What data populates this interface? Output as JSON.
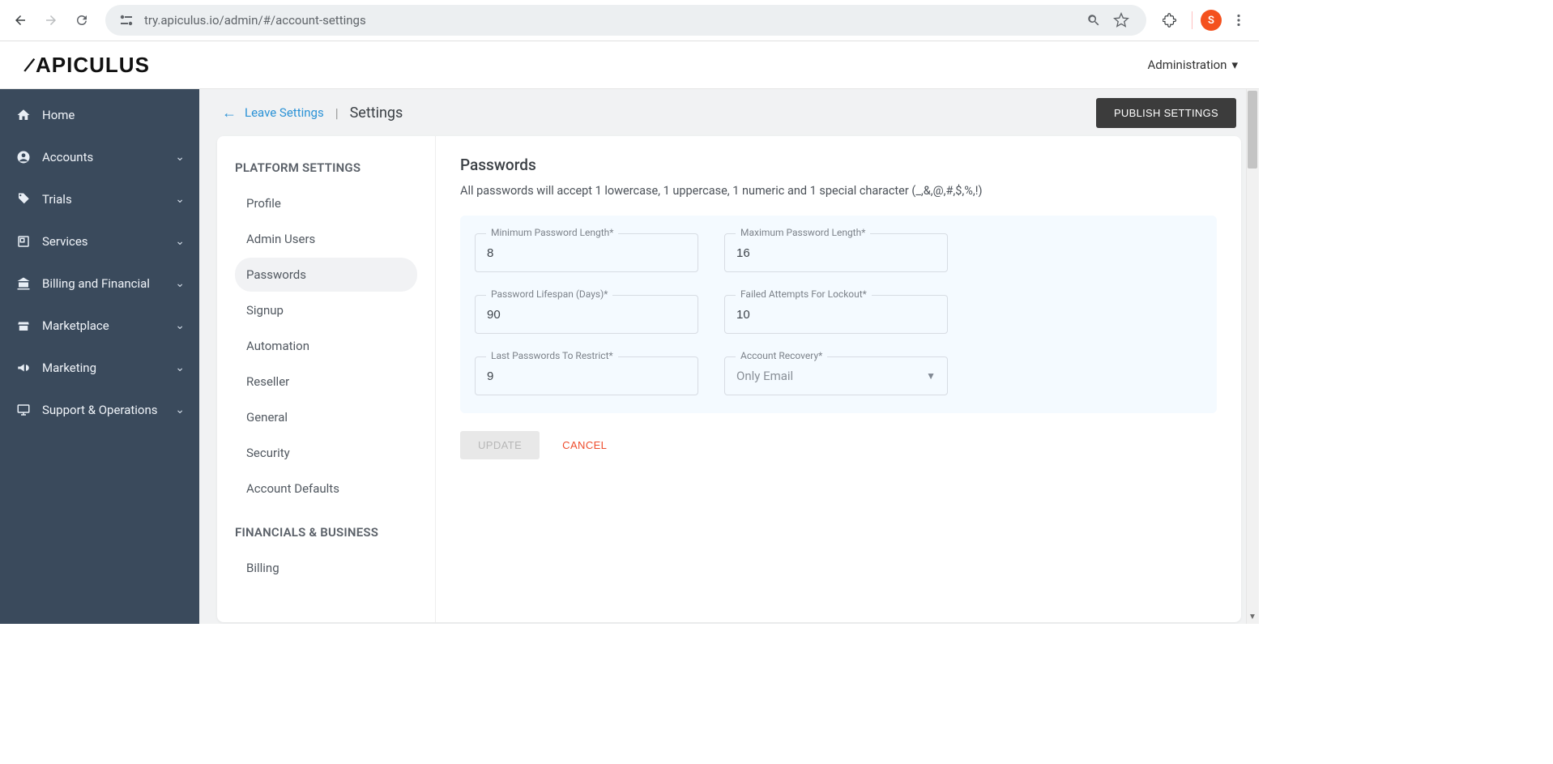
{
  "browser": {
    "url": "try.apiculus.io/admin/#/account-settings",
    "profile_initial": "S"
  },
  "header": {
    "logo_text": "APICULUS",
    "admin_label": "Administration"
  },
  "sidebar": {
    "items": [
      {
        "label": "Home",
        "icon": "home",
        "expandable": false
      },
      {
        "label": "Accounts",
        "icon": "user",
        "expandable": true
      },
      {
        "label": "Trials",
        "icon": "tag",
        "expandable": true
      },
      {
        "label": "Services",
        "icon": "layers",
        "expandable": true
      },
      {
        "label": "Billing and Financial",
        "icon": "bank",
        "expandable": true
      },
      {
        "label": "Marketplace",
        "icon": "store",
        "expandable": true
      },
      {
        "label": "Marketing",
        "icon": "megaphone",
        "expandable": true
      },
      {
        "label": "Support & Operations",
        "icon": "monitor",
        "expandable": true
      }
    ]
  },
  "top_actions": {
    "leave_label": "Leave Settings",
    "title": "Settings",
    "publish_label": "PUBLISH SETTINGS"
  },
  "settings_nav": {
    "section1_title": "PLATFORM SETTINGS",
    "section1": [
      "Profile",
      "Admin Users",
      "Passwords",
      "Signup",
      "Automation",
      "Reseller",
      "General",
      "Security",
      "Account Defaults"
    ],
    "section2_title": "FINANCIALS & BUSINESS",
    "section2": [
      "Billing"
    ],
    "active": "Passwords"
  },
  "panel": {
    "title": "Passwords",
    "hint": "All passwords will accept 1 lowercase, 1 uppercase, 1 numeric and 1 special character (_,&,@,#,$,%,!)",
    "fields": {
      "min_len": {
        "label": "Minimum Password Length*",
        "value": "8"
      },
      "max_len": {
        "label": "Maximum Password Length*",
        "value": "16"
      },
      "lifespan": {
        "label": "Password Lifespan (Days)*",
        "value": "90"
      },
      "lockout": {
        "label": "Failed Attempts For Lockout*",
        "value": "10"
      },
      "restrict": {
        "label": "Last Passwords To Restrict*",
        "value": "9"
      },
      "recovery": {
        "label": "Account Recovery*",
        "value": "Only Email"
      }
    },
    "update_label": "UPDATE",
    "cancel_label": "CANCEL"
  }
}
